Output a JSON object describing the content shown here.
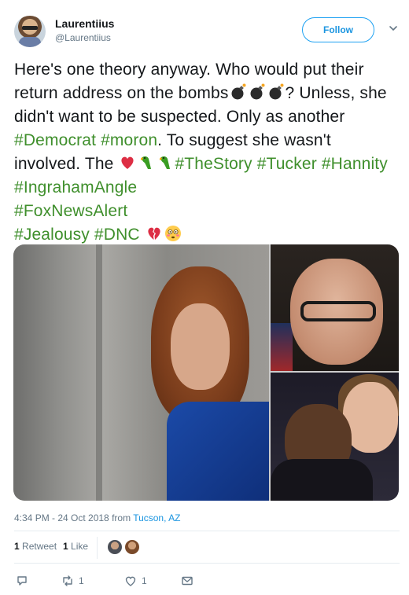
{
  "author": {
    "name": "Laurentiius",
    "handle": "@Laurentiius",
    "follow_label": "Follow"
  },
  "tweet": {
    "segments": {
      "s1": "Here's one theory anyway. Who would put their return address on the bombs",
      "s2": "? Unless, she didn't want to be suspected. Only as another ",
      "h1": "#Democrat",
      "sp1": " ",
      "h2": "#moron",
      "s3": ". To suggest she wasn't involved. The ",
      "h3": "#TheStory",
      "h4": "#Tucker",
      "h5": "#Hannity",
      "h6": "#IngrahamAngle",
      "h7": "#FoxNewsAlert",
      "h8": "#Jealousy",
      "h9": "#DNC"
    },
    "emoji": [
      "bomb",
      "bomb",
      "bomb",
      "red-heart",
      "parrot",
      "parrot",
      "broken-heart",
      "flushed-face"
    ]
  },
  "meta": {
    "time": "4:34 PM - 24 Oct 2018 from ",
    "location": "Tucson, AZ"
  },
  "stats": {
    "retweets_count": "1",
    "retweets_label": "Retweet",
    "likes_count": "1",
    "likes_label": "Like"
  },
  "actions": {
    "retweet_count": "1",
    "like_count": "1"
  },
  "colors": {
    "hashtag": "#3f8f2c",
    "accent": "#1da1f2",
    "muted": "#657786"
  }
}
